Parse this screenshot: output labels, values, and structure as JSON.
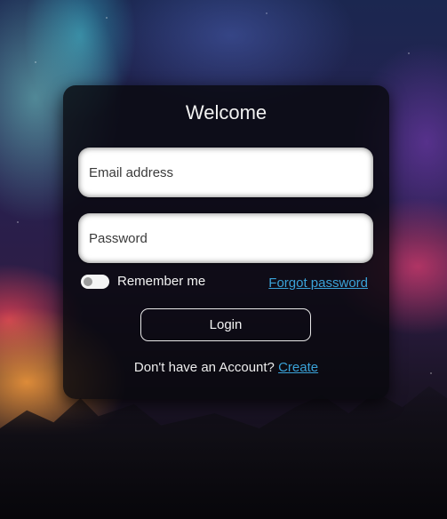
{
  "form": {
    "title": "Welcome",
    "email_placeholder": "Email address",
    "password_placeholder": "Password",
    "remember_label": "Remember me",
    "remember_checked": false,
    "forgot_label": "Forgot password",
    "login_label": "Login",
    "signup_prompt": "Don't have an Account?",
    "signup_link": "Create"
  },
  "colors": {
    "link": "#3aa2d8",
    "card_background": "#08080e",
    "text": "#f2f2f2"
  }
}
